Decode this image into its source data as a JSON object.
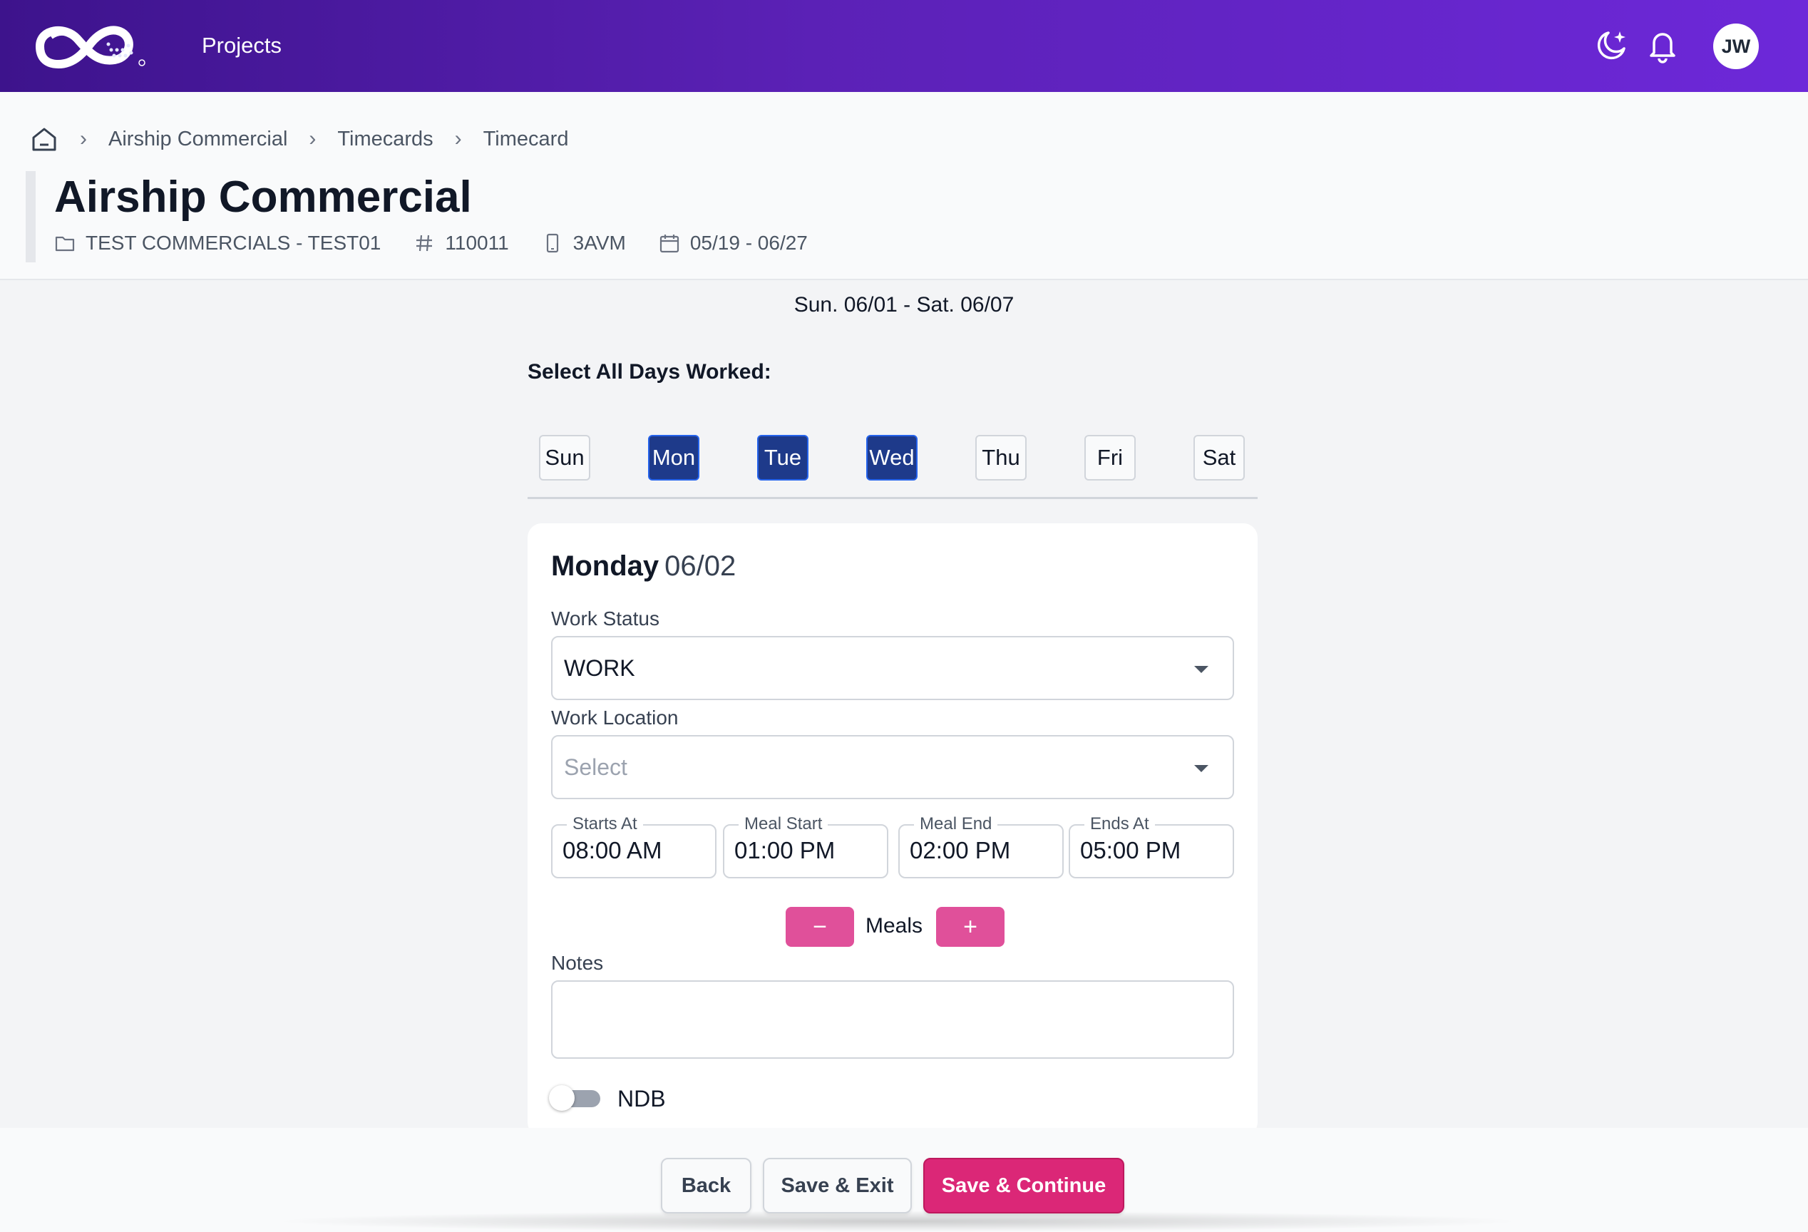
{
  "topbar": {
    "nav_projects": "Projects",
    "avatar_initials": "JW",
    "icons": [
      "logo-icon",
      "dark-mode-icon",
      "bell-icon"
    ]
  },
  "breadcrumb": [
    "Airship Commercial",
    "Timecards",
    "Timecard"
  ],
  "header": {
    "title": "Airship Commercial",
    "meta": {
      "project": "TEST COMMERCIALS - TEST01",
      "number": "110011",
      "code": "3AVM",
      "dates": "05/19 - 06/27"
    }
  },
  "week": {
    "range": "Sun. 06/01 - Sat. 06/07"
  },
  "days_worked": {
    "label": "Select All Days Worked:",
    "days": [
      {
        "label": "Sun",
        "selected": false
      },
      {
        "label": "Mon",
        "selected": true
      },
      {
        "label": "Tue",
        "selected": true
      },
      {
        "label": "Wed",
        "selected": true
      },
      {
        "label": "Thu",
        "selected": false
      },
      {
        "label": "Fri",
        "selected": false
      },
      {
        "label": "Sat",
        "selected": false
      }
    ]
  },
  "day_card": {
    "day_name": "Monday",
    "day_date": "06/02",
    "work_status": {
      "label": "Work Status",
      "value": "WORK"
    },
    "work_location": {
      "label": "Work Location",
      "placeholder": "Select"
    },
    "times": {
      "starts_at": {
        "label": "Starts At",
        "value": "08:00 AM"
      },
      "meal_start": {
        "label": "Meal Start",
        "value": "01:00 PM"
      },
      "meal_end": {
        "label": "Meal End",
        "value": "02:00 PM"
      },
      "ends_at": {
        "label": "Ends At",
        "value": "05:00 PM"
      }
    },
    "meals": {
      "label": "Meals",
      "minus": "−",
      "plus": "+"
    },
    "notes": {
      "label": "Notes",
      "value": ""
    },
    "ndb": {
      "label": "NDB",
      "on": false
    }
  },
  "footer": {
    "back": "Back",
    "save_exit": "Save & Exit",
    "save_continue": "Save & Continue"
  },
  "colors": {
    "topbar_start": "#3d138c",
    "topbar_end": "#6d28d9",
    "day_selected": "#1e3a8a",
    "meal_button": "#e0509a",
    "primary_button": "#db2777"
  }
}
